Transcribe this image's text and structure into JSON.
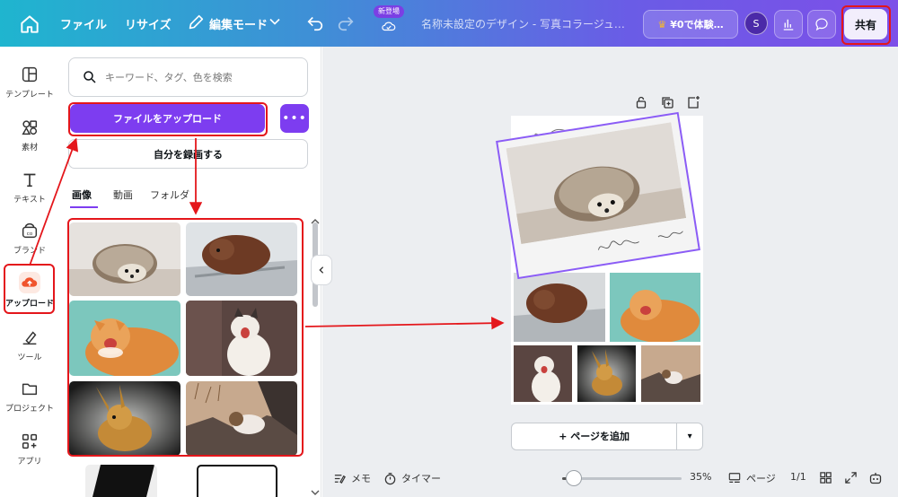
{
  "topbar": {
    "file_menu": "ファイル",
    "resize_menu": "リサイズ",
    "edit_mode": "編集モード",
    "new_badge": "新登場",
    "doc_title": "名称未設定のデザイン - 写真コラージュ（…",
    "trial_button": "¥0で体験…",
    "avatar_initial": "S",
    "share_button": "共有"
  },
  "rail": {
    "items": [
      {
        "label": "テンプレート",
        "icon": "template-icon"
      },
      {
        "label": "素材",
        "icon": "elements-icon"
      },
      {
        "label": "テキスト",
        "icon": "text-icon"
      },
      {
        "label": "ブランド",
        "icon": "brand-icon"
      },
      {
        "label": "アップロード",
        "icon": "upload-icon"
      },
      {
        "label": "ツール",
        "icon": "tools-icon"
      },
      {
        "label": "プロジェクト",
        "icon": "projects-icon"
      },
      {
        "label": "アプリ",
        "icon": "apps-icon"
      }
    ]
  },
  "panel": {
    "search_placeholder": "キーワード、タグ、色を検索",
    "upload_button": "ファイルをアップロード",
    "more_button": "•••",
    "record_button": "自分を録画する",
    "tabs": [
      "画像",
      "動画",
      "フォルダ"
    ]
  },
  "canvas": {
    "add_page": "+ ページを追加"
  },
  "bottombar": {
    "notes": "メモ",
    "timer": "タイマー",
    "zoom_value": 35,
    "zoom_label": "35%",
    "pages_label": "ページ",
    "page_counter": "1/1"
  },
  "colors": {
    "accent": "#7d3df0",
    "annotation": "#e4161b"
  }
}
